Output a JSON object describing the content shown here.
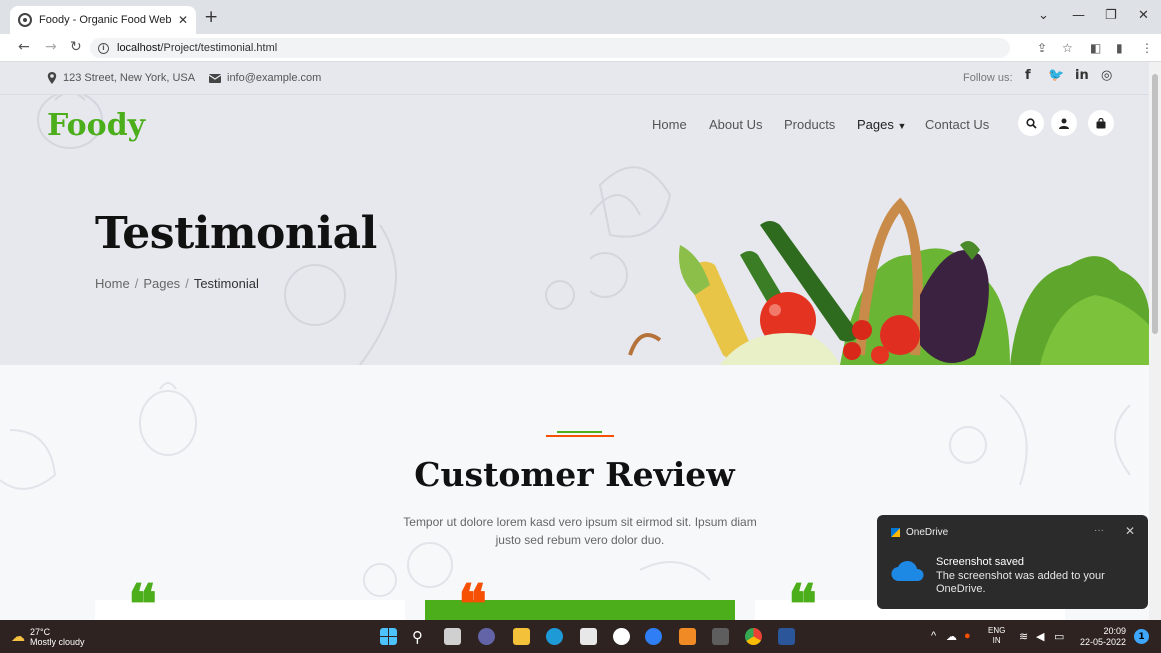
{
  "browser": {
    "tab_title": "Foody - Organic Food Website Te",
    "url_host": "localhost",
    "url_path": "/Project/testimonial.html"
  },
  "topbar": {
    "address": "123 Street, New York, USA",
    "email": "info@example.com",
    "follow_label": "Follow us:"
  },
  "logo": {
    "main": "Foo",
    "accent": "dy"
  },
  "nav": {
    "items": [
      "Home",
      "About Us",
      "Products",
      "Pages",
      "Contact Us"
    ]
  },
  "hero": {
    "title": "Testimonial",
    "breadcrumb": [
      "Home",
      "Pages",
      "Testimonial"
    ]
  },
  "section": {
    "title": "Customer Review",
    "description": "Tempor ut dolore lorem kasd vero ipsum sit eirmod sit. Ipsum diam justo sed rebum vero dolor duo."
  },
  "toast": {
    "app": "OneDrive",
    "title": "Screenshot saved",
    "body": "The screenshot was added to your OneDrive."
  },
  "taskbar": {
    "temp": "27°C",
    "weather": "Mostly cloudy",
    "lang_line1": "ENG",
    "lang_line2": "IN",
    "time": "20:09",
    "date": "22-05-2022",
    "notif_count": "1"
  },
  "colors": {
    "brand_green": "#4cae1b",
    "brand_orange": "#f65005"
  }
}
